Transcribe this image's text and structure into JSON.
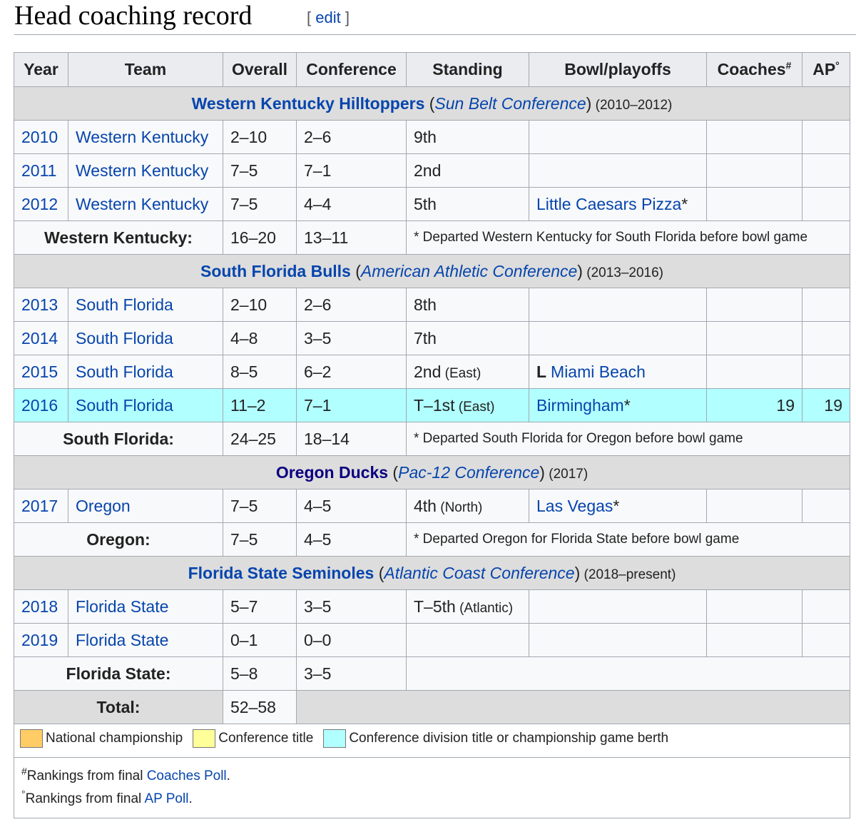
{
  "heading": {
    "title": "Head coaching record",
    "edit_open": "[ ",
    "edit": "edit",
    "edit_close": " ]"
  },
  "columns": [
    "Year",
    "Team",
    "Overall",
    "Conference",
    "Standing",
    "Bowl/playoffs",
    "Coaches",
    "AP"
  ],
  "column_marks": {
    "coaches": "#",
    "ap": "°"
  },
  "sections": [
    {
      "team": "Western Kentucky Hilltoppers",
      "open": " (",
      "conference": "Sun Belt Conference",
      "close": ")",
      "years": " (2010–2012)",
      "rows": [
        {
          "year": "2010",
          "team": "Western Kentucky",
          "overall": "2–10",
          "conf": "2–6",
          "standing": "9th",
          "standing_note": "",
          "bowl_result": "",
          "bowl": "",
          "bowl_mark": "",
          "coaches": "",
          "ap": ""
        },
        {
          "year": "2011",
          "team": "Western Kentucky",
          "overall": "7–5",
          "conf": "7–1",
          "standing": "2nd",
          "standing_note": "",
          "bowl_result": "",
          "bowl": "",
          "bowl_mark": "",
          "coaches": "",
          "ap": ""
        },
        {
          "year": "2012",
          "team": "Western Kentucky",
          "overall": "7–5",
          "conf": "4–4",
          "standing": "5th",
          "standing_note": "",
          "bowl_result": "",
          "bowl": "Little Caesars Pizza",
          "bowl_mark": "*",
          "coaches": "",
          "ap": ""
        }
      ],
      "subtotal": {
        "label": "Western Kentucky:",
        "overall": "16–20",
        "conf": "13–11",
        "note_mark": "*",
        "note": " Departed Western Kentucky for South Florida before bowl game"
      }
    },
    {
      "team": "South Florida Bulls",
      "open": " (",
      "conference": "American Athletic Conference",
      "close": ")",
      "years": " (2013–2016)",
      "rows": [
        {
          "year": "2013",
          "team": "South Florida",
          "overall": "2–10",
          "conf": "2–6",
          "standing": "8th",
          "standing_note": "",
          "bowl_result": "",
          "bowl": "",
          "bowl_mark": "",
          "coaches": "",
          "ap": ""
        },
        {
          "year": "2014",
          "team": "South Florida",
          "overall": "4–8",
          "conf": "3–5",
          "standing": "7th",
          "standing_note": "",
          "bowl_result": "",
          "bowl": "",
          "bowl_mark": "",
          "coaches": "",
          "ap": ""
        },
        {
          "year": "2015",
          "team": "South Florida",
          "overall": "8–5",
          "conf": "6–2",
          "standing": "2nd",
          "standing_note": " (East)",
          "bowl_result": "L ",
          "bowl": "Miami Beach",
          "bowl_mark": "",
          "coaches": "",
          "ap": ""
        },
        {
          "year": "2016",
          "team": "South Florida",
          "overall": "11–2",
          "conf": "7–1",
          "standing": "T–1st",
          "standing_note": " (East)",
          "bowl_result": "",
          "bowl": "Birmingham",
          "bowl_mark": "*",
          "coaches": "19",
          "ap": "19",
          "highlight": true
        }
      ],
      "subtotal": {
        "label": "South Florida:",
        "overall": "24–25",
        "conf": "18–14",
        "note_mark": "*",
        "note": " Departed South Florida for Oregon before bowl game"
      }
    },
    {
      "team": "Oregon Ducks",
      "open": " (",
      "conference": "Pac-12 Conference",
      "close": ")",
      "years": " (2017)",
      "visited": true,
      "rows": [
        {
          "year": "2017",
          "team": "Oregon",
          "overall": "7–5",
          "conf": "4–5",
          "standing": "4th",
          "standing_note": " (North)",
          "bowl_result": "",
          "bowl": "Las Vegas",
          "bowl_mark": "*",
          "coaches": "",
          "ap": ""
        }
      ],
      "subtotal": {
        "label": "Oregon:",
        "overall": "7–5",
        "conf": "4–5",
        "note_mark": "*",
        "note": " Departed Oregon for Florida State before bowl game"
      }
    },
    {
      "team": "Florida State Seminoles",
      "open": " (",
      "conference": "Atlantic Coast Conference",
      "close": ")",
      "years": " (2018–present)",
      "rows": [
        {
          "year": "2018",
          "team": "Florida State",
          "overall": "5–7",
          "conf": "3–5",
          "standing": "T–5th",
          "standing_note": " (Atlantic)",
          "bowl_result": "",
          "bowl": "",
          "bowl_mark": "",
          "coaches": "",
          "ap": ""
        },
        {
          "year": "2019",
          "team": "Florida State",
          "overall": "0–1",
          "conf": "0–0",
          "standing": "",
          "standing_note": "",
          "bowl_result": "",
          "bowl": "",
          "bowl_mark": "",
          "coaches": "",
          "ap": ""
        }
      ],
      "subtotal": {
        "label": "Florida State:",
        "overall": "5–8",
        "conf": "3–5",
        "note_mark": "",
        "note": ""
      }
    }
  ],
  "total": {
    "label": "Total:",
    "overall": "52–58"
  },
  "legend": [
    {
      "label": "National championship",
      "color": "#ffcc66"
    },
    {
      "label": "Conference title",
      "color": "#ffff99"
    },
    {
      "label": "Conference division title or championship game berth",
      "color": "#b2ffff"
    }
  ],
  "footnotes": [
    {
      "mark": "#",
      "text": "Rankings from final ",
      "link": "Coaches Poll",
      "end": "."
    },
    {
      "mark": "°",
      "text": "Rankings from final ",
      "link": "AP Poll",
      "end": "."
    }
  ],
  "highlight_color": "#b2ffff"
}
